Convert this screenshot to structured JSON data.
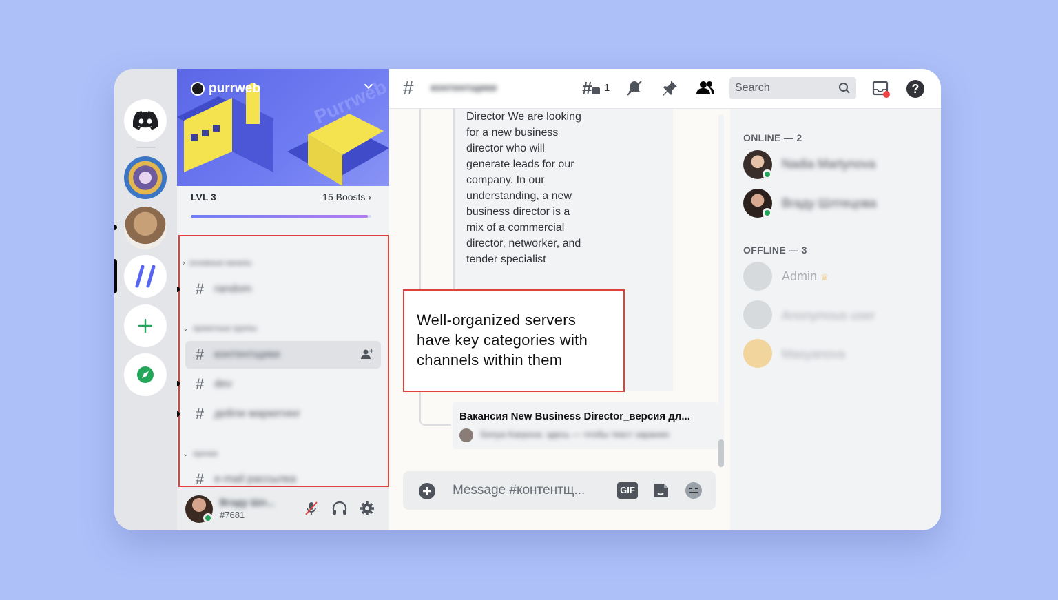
{
  "server": {
    "name": "purrweb",
    "level_label": "LVL 3",
    "boosts_label": "15 Boosts",
    "boost_progress": 0.98
  },
  "sidebar": {
    "categories": [
      "основные каналы",
      "проектные группы",
      "прочее"
    ],
    "channels": [
      "random",
      "контентщики",
      "dev",
      "дейли маркетинг",
      "e-mail рассылка"
    ]
  },
  "user": {
    "name": "Вгаду Шл...",
    "tag": "#7681"
  },
  "header": {
    "channel_name": "контентщики",
    "thread_count": "1",
    "search_placeholder": "Search"
  },
  "embed": {
    "text": "Director We are looking for a new business director who will generate leads for our company. In our understanding, a new business director is a mix of a commercial director, networker, and tender specialist"
  },
  "annotation": {
    "text": "Well-organized servers have key categories with channels within them"
  },
  "thread": {
    "title": "Вакансия New Business Director_версия дл...",
    "preview": "Sonya Karpova: здесь — чтобы текст заранее"
  },
  "composer": {
    "placeholder": "Message #контентщ...",
    "gif_label": "GIF"
  },
  "members": {
    "online_header": "ONLINE — 2",
    "offline_header": "OFFLINE — 3",
    "online": [
      "Nadia Martynova",
      "Вгаду Шлтецова"
    ],
    "offline": [
      "Admin",
      "Anonymous user",
      "Masyanova"
    ]
  },
  "colors": {
    "background": "#aec0f8",
    "blurple": "#5865f2",
    "annotation_red": "#e0413c",
    "online_green": "#23a55a"
  }
}
